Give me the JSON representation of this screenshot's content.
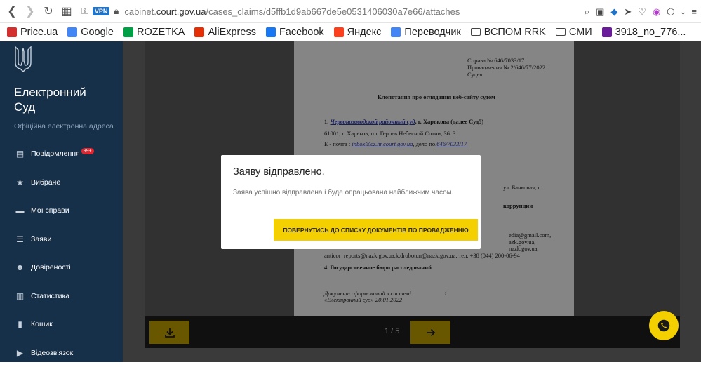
{
  "browser": {
    "url_prefix": "cabinet.",
    "url_domain": "court.gov.ua",
    "url_path": "/cases_claims/d5ffb1d9ab667de5e0531406030a7e66/attaches",
    "vpn_label": "VPN"
  },
  "bookmarks": [
    {
      "label": "Price.ua",
      "icon": "price-ua-icon",
      "color": "#d32f2f"
    },
    {
      "label": "Google",
      "icon": "google-icon",
      "color": "#4285f4"
    },
    {
      "label": "ROZETKA",
      "icon": "rozetka-icon",
      "color": "#00a046"
    },
    {
      "label": "AliExpress",
      "icon": "aliexpress-icon",
      "color": "#e62e04"
    },
    {
      "label": "Facebook",
      "icon": "facebook-icon",
      "color": "#1877f2"
    },
    {
      "label": "Яндекс",
      "icon": "yandex-icon",
      "color": "#fc3f1d"
    },
    {
      "label": "Переводчик",
      "icon": "translate-icon",
      "color": "#4285f4"
    },
    {
      "label": "ВСПОМ RRK",
      "icon": "folder-icon",
      "color": "#444444"
    },
    {
      "label": "СМИ",
      "icon": "folder-icon",
      "color": "#444444"
    },
    {
      "label": "3918_no_776...",
      "icon": "doc-icon",
      "color": "#6a1b9a"
    }
  ],
  "sidebar": {
    "brand_line1": "Електронний",
    "brand_line2": "Суд",
    "subtitle": "Офіційна електронна адреса",
    "items": [
      {
        "label": "Повідомлення",
        "icon": "message-icon",
        "badge": "99+"
      },
      {
        "label": "Вибране",
        "icon": "star-icon"
      },
      {
        "label": "Мої справи",
        "icon": "folder-icon"
      },
      {
        "label": "Заяви",
        "icon": "list-icon"
      },
      {
        "label": "Довіреності",
        "icon": "users-icon"
      },
      {
        "label": "Статистика",
        "icon": "chart-icon"
      },
      {
        "label": "Кошик",
        "icon": "trash-icon"
      },
      {
        "label": "Відеозв'язок",
        "icon": "video-icon"
      }
    ]
  },
  "document": {
    "case_line": "Справа № 646/7033/17",
    "proceeding_line": "Провадження № 2/646/77/2022",
    "judge_line": "Судья",
    "title": "Клопотання про оглядання веб-сайту судом",
    "item1_num": "1.",
    "item1_link": "Червонозаводской районный суд",
    "item1_rest": ", г. Харькова (далее Суд5)",
    "address_line": "61001, г. Харьков, пл. Героев Небесной Сотни, 36. 3",
    "email_prefix": "Е - почта :",
    "email_link": "inbox@cz.hr.court.gov.ua",
    "email_mid": ", дело по.",
    "email_case": "646/7033/17",
    "frag_street": "ул. Банковая, г.",
    "frag_corruption": "коррупции",
    "frag_media": "edia@gmail.com,",
    "frag_nazk": "azk.gov.ua,",
    "frag_nazk2": "nazk.gov.ua,",
    "anticor_line": "anticor_reports@nazk.gov.ua,k.drobotun@nazk.gov.ua. тел. +38 (044) 200-06-94",
    "item4": "4. Государственное бюро расследований",
    "footer_line1": "Документ сформований в системі",
    "footer_page": "1",
    "footer_line2": "«Електронний суд» 20.01.2022"
  },
  "viewer": {
    "page_indicator": "1 / 5",
    "download_icon": "download-icon",
    "next_icon": "arrow-right-icon"
  },
  "modal": {
    "title": "Заяву відправлено.",
    "message": "Заява успішно відправлена і буде опрацьована найближчим часом.",
    "button_label": "ПОВЕРНУТИСЬ ДО СПИСКУ ДОКУМЕНТІВ ПО ПРОВАДЖЕННЮ"
  },
  "colors": {
    "sidebar_bg": "#173049",
    "accent_yellow": "#f5d000",
    "badge_red": "#e2262f"
  }
}
